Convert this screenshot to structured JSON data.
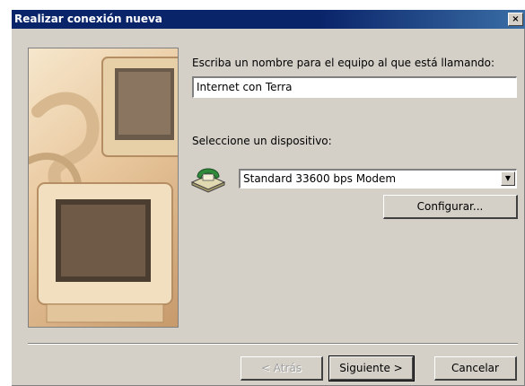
{
  "window": {
    "title": "Realizar conexión nueva",
    "close_glyph": "×"
  },
  "main": {
    "name_prompt": "Escriba un nombre para el equipo al que está llamando:",
    "name_value": "Internet con Terra",
    "device_prompt": "Seleccione un dispositivo:",
    "device_value": "Standard 33600 bps Modem",
    "configure_label": "Configurar..."
  },
  "footer": {
    "back_label": "< Atrás",
    "next_label": "Siguiente >",
    "cancel_label": "Cancelar"
  },
  "icons": {
    "modem": "modem-phone-icon",
    "illustration": "computer-monitors-illustration"
  }
}
